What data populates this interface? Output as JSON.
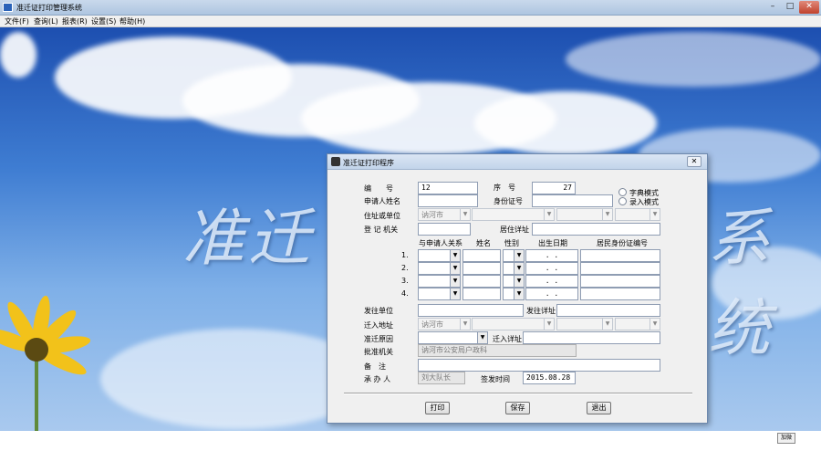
{
  "window": {
    "title": "准迁证打印管理系统",
    "min": "–",
    "max": "□",
    "close": "✕"
  },
  "menu": [
    {
      "label": "文件(F)"
    },
    {
      "label": "查询(L)"
    },
    {
      "label": "报表(R)"
    },
    {
      "label": "设置(S)"
    },
    {
      "label": "帮助(H)"
    }
  ],
  "background": {
    "title_left": "准迁",
    "title_right": "系统"
  },
  "dialog": {
    "title": "准迁证打印程序",
    "close": "✕",
    "fields": {
      "bianhao_label": "编　　号",
      "bianhao_value": "12",
      "xuhao_label": "序　号",
      "xuhao_value": "27",
      "applicant_name_label": "申请人姓名",
      "id_number_label": "身份证号",
      "address_label": "住址或单位",
      "address_city": "讷河市",
      "registry_label": "登 记 机关",
      "residence_detail_label": "居住详址",
      "origin_unit_label": "发往单位",
      "origin_detail_label": "发往详址",
      "move_in_label": "迁入地址",
      "move_in_city": "讷河市",
      "reason_label": "准迁原因",
      "move_in_detail_label": "迁入详址",
      "approval_label": "批准机关",
      "approval_value": "讷河市公安局户政科",
      "remarks_label": "备　注",
      "handler_label": "承 办 人",
      "handler_value": "刘大队长",
      "issue_time_label": "签发时间",
      "issue_time_value": "2015.08.28"
    },
    "modes": [
      {
        "label": "字典模式"
      },
      {
        "label": "录入模式"
      }
    ],
    "table": {
      "headers": [
        "与申请人关系",
        "姓名",
        "性别",
        "出生日期",
        "居民身份证编号"
      ],
      "rows": [
        "1.",
        "2.",
        "3.",
        "4."
      ],
      "date_placeholder": ".  ."
    },
    "buttons": {
      "print": "打印",
      "save": "保存",
      "exit": "退出"
    }
  },
  "status": {
    "box": "加微"
  }
}
